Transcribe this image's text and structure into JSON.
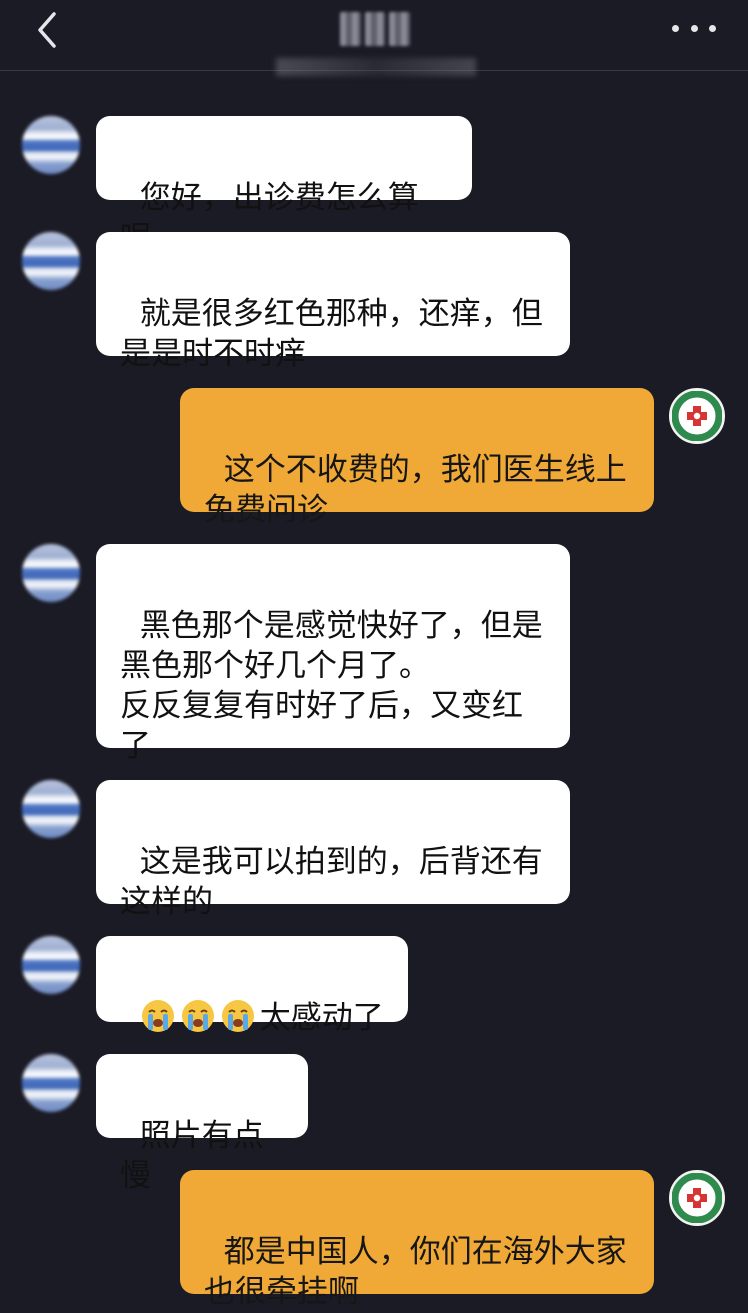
{
  "header": {
    "back_icon": "chevron-left-icon",
    "more_icon": "more-dots-icon",
    "title_obscured": true
  },
  "colors": {
    "background": "#1b1b26",
    "incoming_bubble": "#ffffff",
    "outgoing_bubble": "#f0a936",
    "text": "#111111"
  },
  "messages": [
    {
      "sender": "user",
      "text": "您好，出诊费怎么算呢"
    },
    {
      "sender": "user",
      "text": "就是很多红色那种，还痒，但是是时不时痒"
    },
    {
      "sender": "hospital",
      "text": "这个不收费的，我们医生线上免费问诊"
    },
    {
      "sender": "user",
      "text": "黑色那个是感觉快好了，但是黑色那个好几个月了。\n反反复复有时好了后，又变红了"
    },
    {
      "sender": "user",
      "text": "这是我可以拍到的，后背还有这样的"
    },
    {
      "sender": "user",
      "text": "太感动了",
      "emoji": [
        "loudly-crying-face-icon",
        "loudly-crying-face-icon",
        "loudly-crying-face-icon"
      ]
    },
    {
      "sender": "user",
      "text": "照片有点慢"
    },
    {
      "sender": "hospital",
      "text": "都是中国人，你们在海外大家也很牵挂啊"
    }
  ],
  "avatars": {
    "user": "user-avatar-blurred",
    "hospital": "hospital-logo-avatar"
  }
}
